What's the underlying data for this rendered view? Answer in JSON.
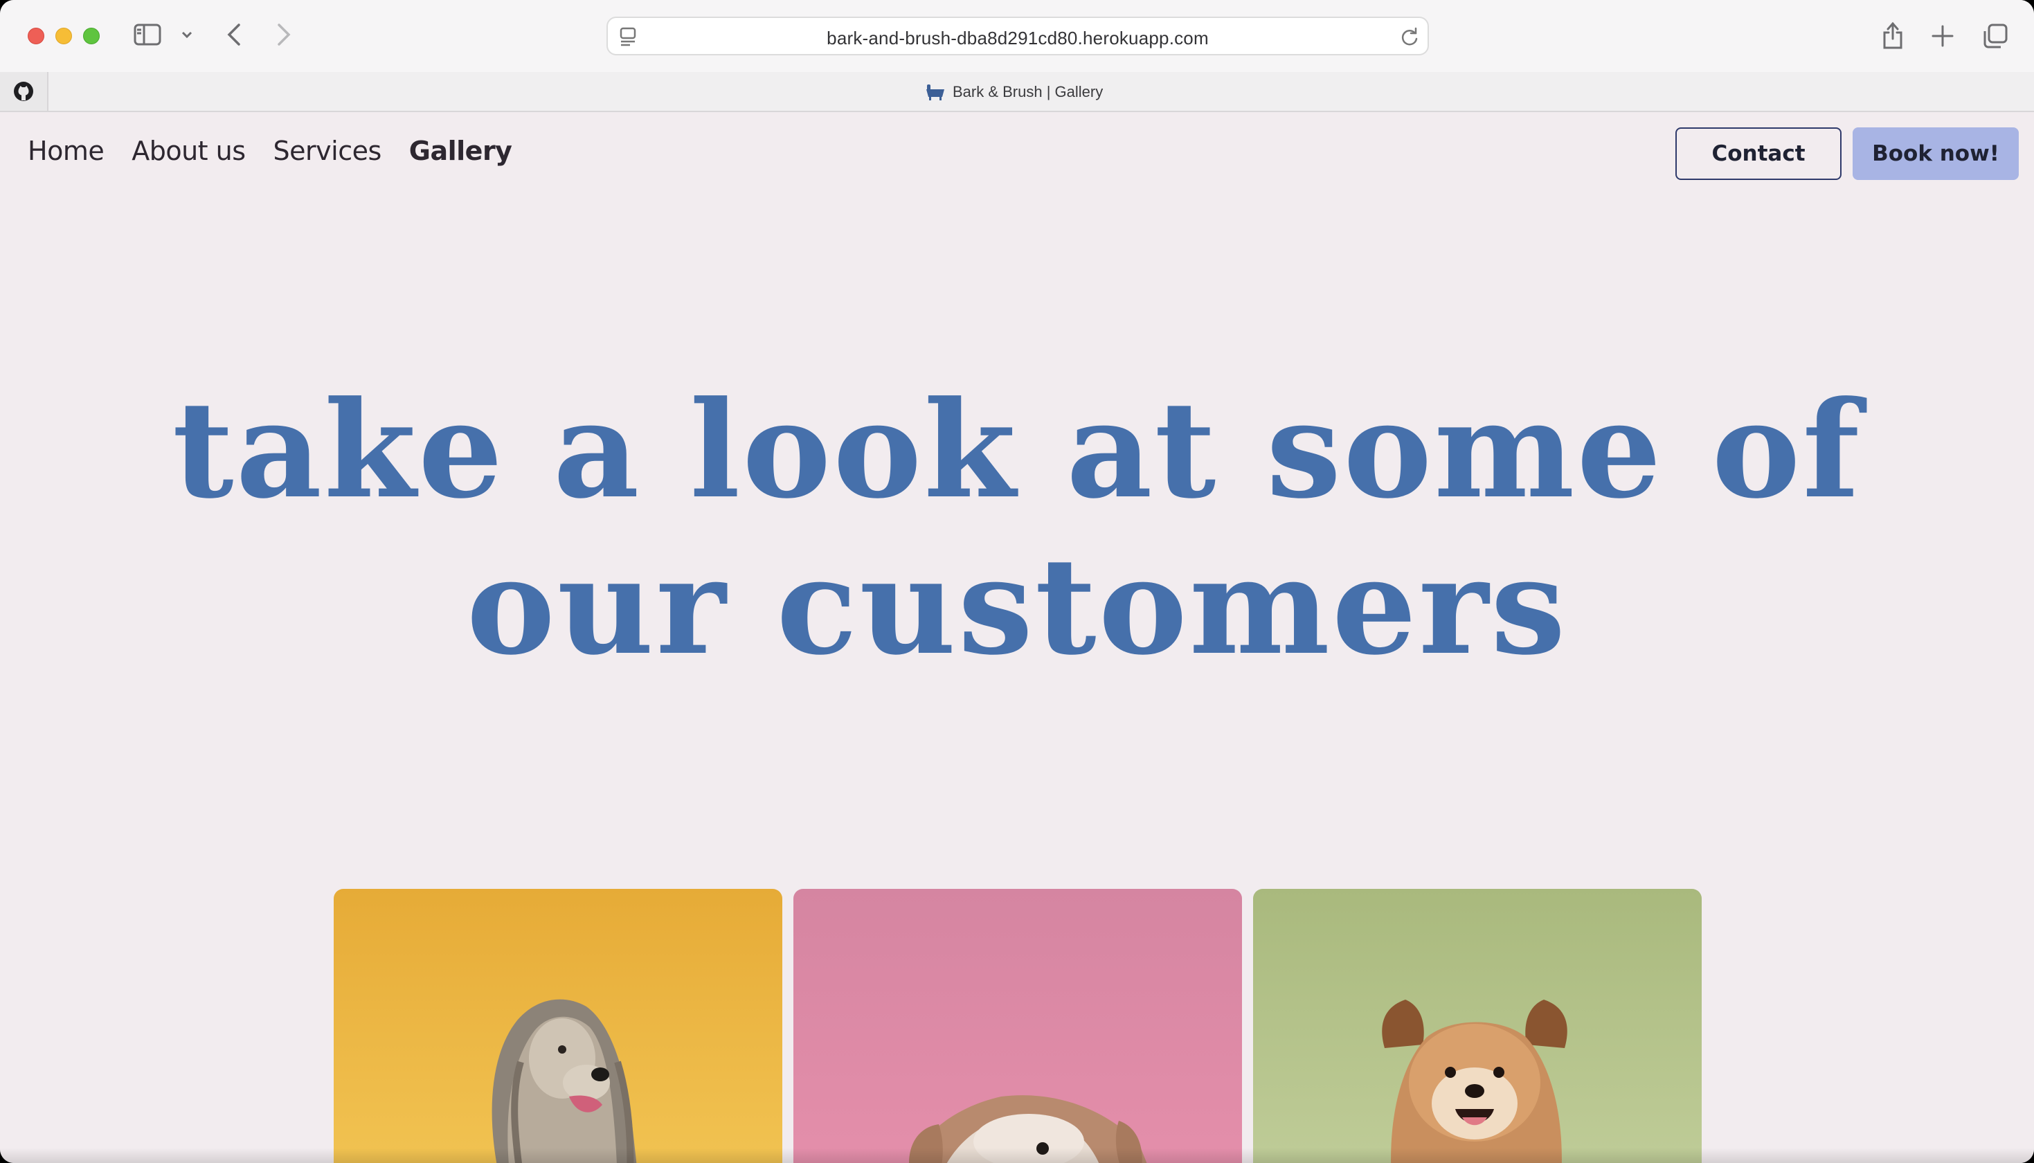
{
  "browser": {
    "url": "bark-and-brush-dba8d291cd80.herokuapp.com",
    "tab_title": "Bark & Brush | Gallery"
  },
  "nav": {
    "items": [
      {
        "label": "Home",
        "active": false
      },
      {
        "label": "About us",
        "active": false
      },
      {
        "label": "Services",
        "active": false
      },
      {
        "label": "Gallery",
        "active": true
      }
    ],
    "contact_label": "Contact",
    "book_label": "Book now!"
  },
  "hero": {
    "line1": "take a look at some of",
    "line2": "our customers"
  },
  "gallery": {
    "cards": [
      {
        "subject": "afghan-hound",
        "color": "#eab640"
      },
      {
        "subject": "fluffy-dog",
        "color": "#de8aa6"
      },
      {
        "subject": "pomeranian-mix",
        "color": "#b7c48c"
      }
    ]
  },
  "colors": {
    "page_bg": "#f2ecef",
    "accent": "#4670ab",
    "book_button": "#a8b4e4"
  }
}
